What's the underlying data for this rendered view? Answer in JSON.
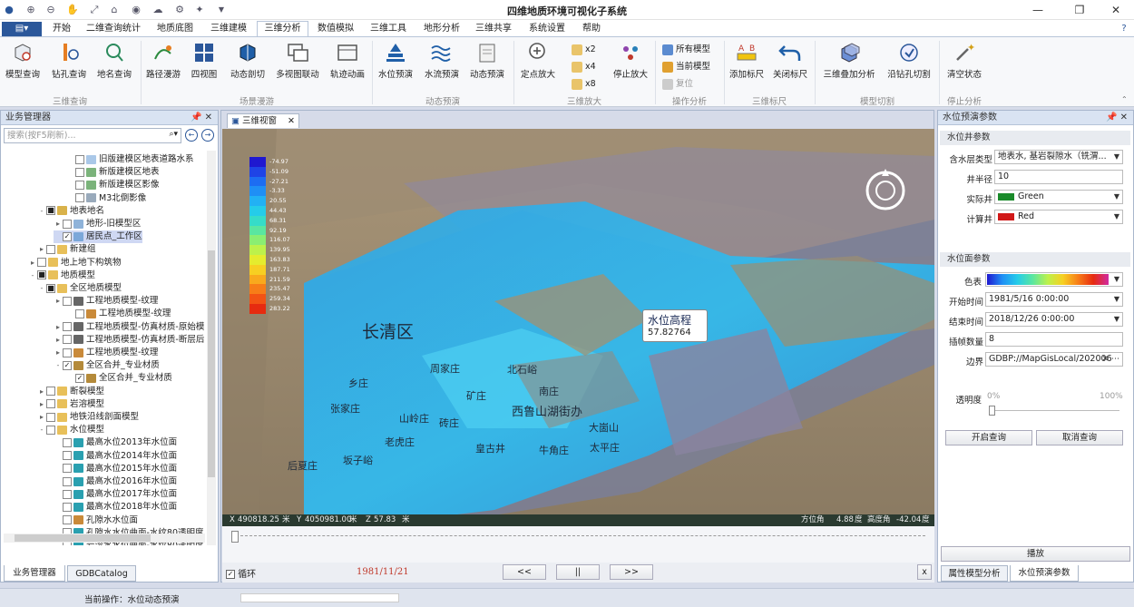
{
  "app": {
    "title": "四维地质环境可视化子系统"
  },
  "tabs": [
    {
      "label": "开始"
    },
    {
      "label": "二维查询统计"
    },
    {
      "label": "地质底图"
    },
    {
      "label": "三维建模"
    },
    {
      "label": "三维分析"
    },
    {
      "label": "数值模拟"
    },
    {
      "label": "三维工具"
    },
    {
      "label": "地形分析"
    },
    {
      "label": "三维共享"
    },
    {
      "label": "系统设置"
    },
    {
      "label": "帮助"
    }
  ],
  "ribbon": {
    "model_query": "模型查询",
    "drill_query": "钻孔查询",
    "place_query": "地名查询",
    "path_roam": "路径漫游",
    "four_view": "四视图",
    "dyn_section": "动态剖切",
    "multi_view": "多视图联动",
    "track_anim": "轨迹动画",
    "water_level": "水位预演",
    "water_flow": "水流预演",
    "dyn_preview": "动态预演",
    "fixed_zoom": "定点放大",
    "x2": "x2",
    "x4": "x4",
    "x8": "x8",
    "stop_zoom": "停止放大",
    "all_models": "所有模型",
    "current_model": "当前模型",
    "reset": "复位",
    "add_scale": "添加标尺",
    "close_scale": "关闭标尺",
    "overlay": "三维叠加分析",
    "drill_cut": "沿钻孔切割",
    "clear_state": "清空状态",
    "groups": {
      "g1": "三维查询",
      "g2": "场景漫游",
      "g3": "动态预演",
      "g4": "三维放大",
      "g5": "操作分析",
      "g6": "三维标尺",
      "g7": "模型切割",
      "g8": "停止分析"
    }
  },
  "left_panel": {
    "title": "业务管理器",
    "search_placeholder": "搜索(按F5刷新)...",
    "tree": [
      {
        "label": "旧版建模区地表道路水系"
      },
      {
        "label": "新版建模区地表"
      },
      {
        "label": "新版建模区影像"
      },
      {
        "label": "M3北倒影像"
      },
      {
        "label": "地表地名"
      },
      {
        "label": "地形-旧模型区"
      },
      {
        "label": "居民点_工作区"
      },
      {
        "label": "新建组"
      },
      {
        "label": "地上地下构筑物"
      },
      {
        "label": "地质模型"
      },
      {
        "label": "全区地质模型"
      },
      {
        "label": "工程地质模型-纹理"
      },
      {
        "label": "工程地质模型-纹理"
      },
      {
        "label": "工程地质模型-仿真材质-原始模"
      },
      {
        "label": "工程地质模型-仿真材质-断层后"
      },
      {
        "label": "工程地质模型-纹理"
      },
      {
        "label": "全区合并_专业材质"
      },
      {
        "label": "全区合并_专业材质"
      },
      {
        "label": "断裂模型"
      },
      {
        "label": "岩溶模型"
      },
      {
        "label": "地铁沿线剖面模型"
      },
      {
        "label": "水位模型"
      },
      {
        "label": "最高水位2013年水位面"
      },
      {
        "label": "最高水位2014年水位面"
      },
      {
        "label": "最高水位2015年水位面"
      },
      {
        "label": "最高水位2016年水位面"
      },
      {
        "label": "最高水位2017年水位面"
      },
      {
        "label": "最高水位2018年水位面"
      },
      {
        "label": "孔隙水水位面"
      },
      {
        "label": "孔隙水水位曲面-水纹80透明度"
      },
      {
        "label": "岩溶水水位曲面-水纹80透明度"
      }
    ],
    "bottom_tabs": [
      "业务管理器",
      "GDBCatalog"
    ]
  },
  "map": {
    "tab": "三维视窗",
    "legend": [
      "-74.97",
      "-51.09",
      "-27.21",
      "-3.33",
      "20.55",
      "44.43",
      "68.31",
      "92.19",
      "116.07",
      "139.95",
      "163.83",
      "187.71",
      "211.59",
      "235.47",
      "259.34",
      "283.22"
    ],
    "legend_colors": [
      "#1f18d0",
      "#1f44e6",
      "#1d6df2",
      "#1f8ff5",
      "#22b1f4",
      "#25cce9",
      "#36dcc8",
      "#5ae6a0",
      "#8aee72",
      "#bdf14b",
      "#e5ec2e",
      "#f7cf22",
      "#f9a91d",
      "#f77d18",
      "#f25314",
      "#e62b10"
    ],
    "place_labels": {
      "changqing": "长清区",
      "shuiwei": "水位高程",
      "value": "57.82764",
      "sanshan": "西鲁山湖街办",
      "dajishan": "大崮山",
      "taiping": "太平庄",
      "laohu": "老虎庄",
      "houxia": "后夏庄",
      "yanzi": "坂子峪",
      "huangguzhuang": "皇古井",
      "zhangjiazhuang": "张家庄",
      "shanling": "山岭庄",
      "zhuanghu": "砖庄",
      "kuangzhuang": "矿庄",
      "nanzhuang": "南庄",
      "zhoujia": "周家庄",
      "beishi": "北石峪",
      "xiangzhuang": "乡庄",
      "niutou": "牛角庄"
    },
    "coords": {
      "x_label": "X",
      "x": "490818.25",
      "x_unit": "米",
      "y_label": "Y",
      "y": "4050981.00",
      "y_unit": "米",
      "z_label": "Z",
      "z": "57.83",
      "z_unit": "米",
      "azimuth_label": "方位角",
      "azimuth": "4.88",
      "azimuth_unit": "度",
      "elev_label": "高度角",
      "elev": "-42.04",
      "elev_unit": "度"
    },
    "loop_label": "循环",
    "date": "1981/11/21",
    "prev": "<<",
    "pause": "||",
    "next": ">>",
    "close": "x"
  },
  "right_panel": {
    "title": "水位预演参数",
    "well_section": "水位井参数",
    "aquifer_label": "含水层类型",
    "aquifer_value": "地表水, 基岩裂隙水（铣渭...",
    "radius_label": "井半径",
    "radius_value": "10",
    "actual_label": "实际井",
    "actual_value": "Green",
    "calc_label": "计算井",
    "calc_value": "Red",
    "surface_section": "水位面参数",
    "color_label": "色表",
    "start_label": "开始时间",
    "start_value": "1981/5/16 0:00:00",
    "end_label": "结束时间",
    "end_value": "2018/12/26 0:00:00",
    "interp_label": "插帧数量",
    "interp_value": "8",
    "border_label": "边界",
    "border_value": "GDBP://MapGisLocal/202006",
    "alpha_label": "透明度",
    "alpha_min": "0%",
    "alpha_max": "100%",
    "open_query": "开启查询",
    "cancel_query": "取消查询",
    "play": "播放",
    "bottom_tabs": [
      "属性模型分析",
      "水位预演参数"
    ]
  },
  "status": {
    "current_op": "当前操作：水位动态预演"
  }
}
